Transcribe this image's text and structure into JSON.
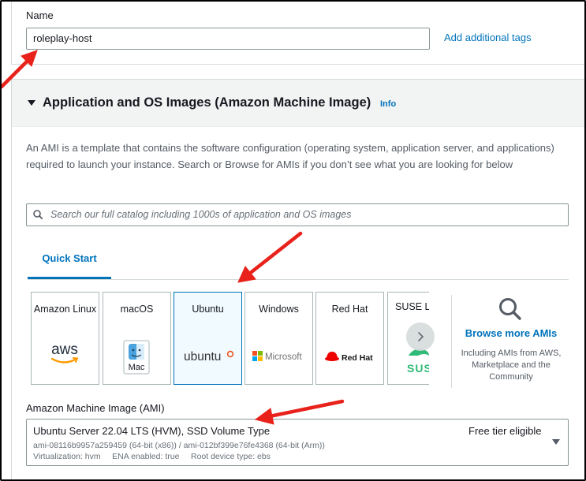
{
  "instance_name": {
    "label": "Name",
    "value": "roleplay-host",
    "add_tags_link": "Add additional tags"
  },
  "ami_section": {
    "title": "Application and OS Images (Amazon Machine Image)",
    "info_link": "Info",
    "description": "An AMI is a template that contains the software configuration (operating system, application server, and applications) required to launch your instance. Search or Browse for AMIs if you don’t see what you are looking for below",
    "search_placeholder": "Search our full catalog including 1000s of application and OS images",
    "tabs": [
      {
        "label": "Quick Start",
        "selected": true
      }
    ],
    "os_tiles": [
      {
        "name": "Amazon Linux",
        "logo_text": "aws",
        "icon": "aws-logo-icon",
        "selected": false
      },
      {
        "name": "macOS",
        "logo_text": "Mac",
        "icon": "mac-finder-icon",
        "selected": false
      },
      {
        "name": "Ubuntu",
        "logo_text": "ubuntu",
        "icon": "ubuntu-logo-icon",
        "selected": true
      },
      {
        "name": "Windows",
        "logo_text": "Microsoft",
        "icon": "microsoft-logo-icon",
        "selected": false
      },
      {
        "name": "Red Hat",
        "logo_text": "Red Hat",
        "icon": "redhat-logo-icon",
        "selected": false
      },
      {
        "name": "SUSE Li",
        "logo_text": "SUS",
        "icon": "suse-logo-icon",
        "selected": false
      }
    ],
    "browse_more": {
      "label": "Browse more AMIs",
      "sublabel": "Including AMIs from AWS, Marketplace and the Community"
    },
    "ami_select": {
      "label": "Amazon Machine Image (AMI)",
      "name": "Ubuntu Server 22.04 LTS (HVM), SSD Volume Type",
      "ids": "ami-08116b9957a259459 (64-bit (x86)) / ami-012bf399e76fe4368 (64-bit (Arm))",
      "meta": "Virtualization: hvm     ENA enabled: true     Root device type: ebs",
      "badge": "Free tier eligible"
    }
  },
  "colors": {
    "link": "#0073bb",
    "annotation_arrow": "#e8221b",
    "selected_tile_bg": "#f1faff",
    "aws_orange": "#ff9900",
    "ubuntu_orange": "#e95420",
    "redhat_red": "#ee0000",
    "suse_green": "#30ba78"
  }
}
